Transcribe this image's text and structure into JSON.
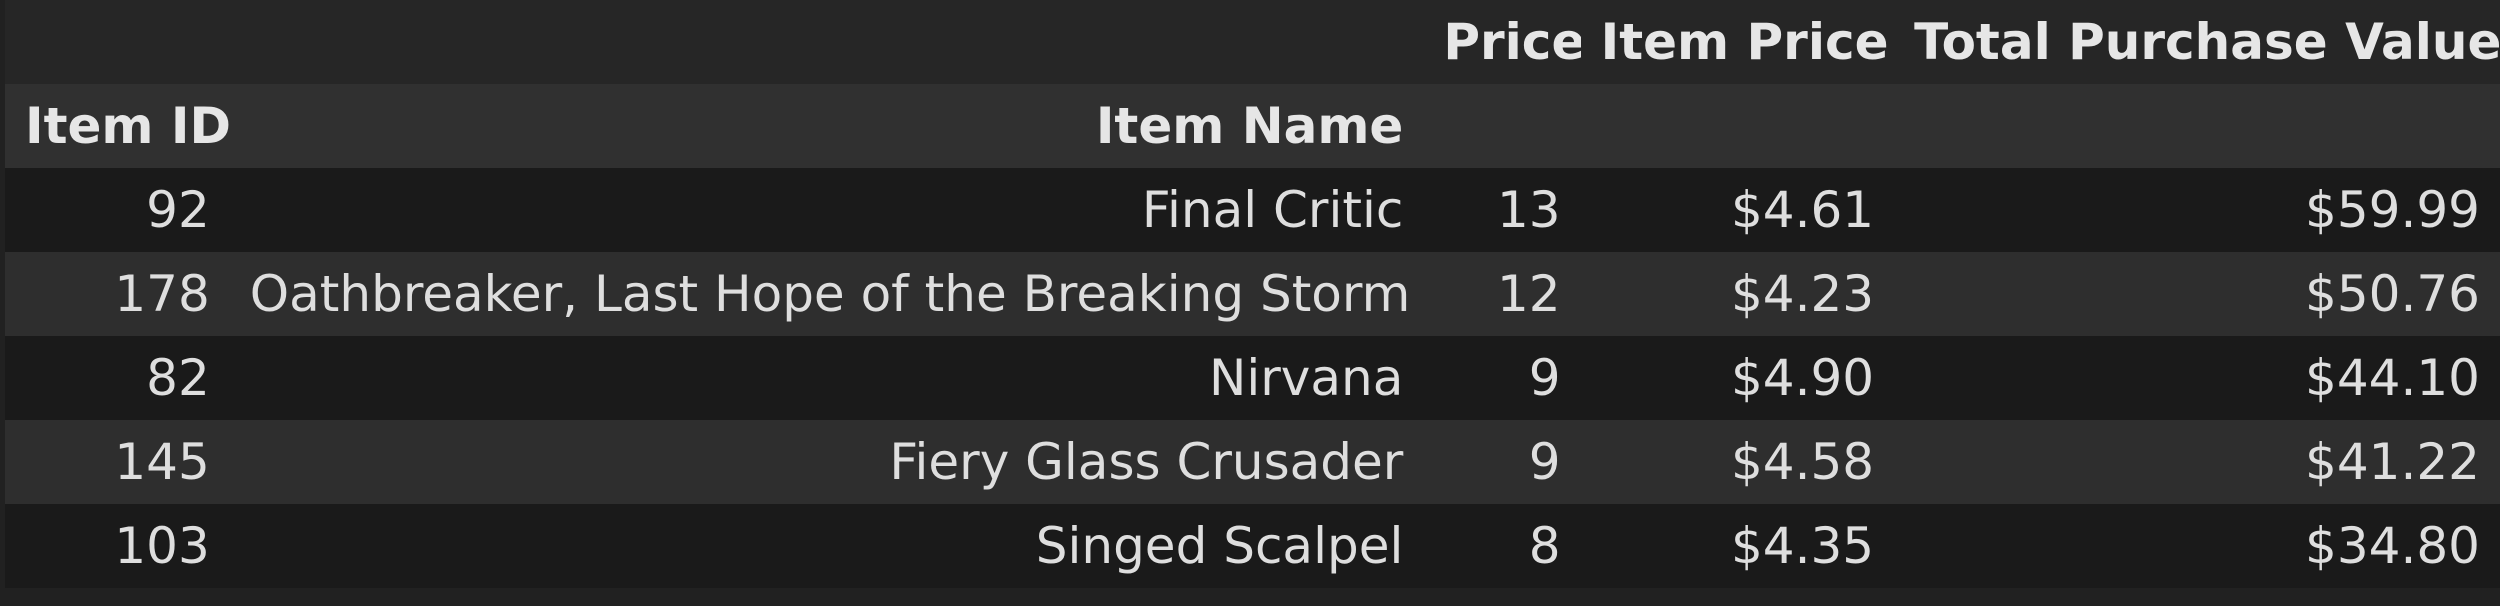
{
  "table": {
    "header_columns": [
      "Price",
      "Item Price",
      "Total Purchase Value"
    ],
    "index_names": [
      "Item ID",
      "Item Name"
    ],
    "rows": [
      {
        "item_id": "92",
        "item_name": "Final Critic",
        "price": "13",
        "item_price": "$4.61",
        "total": "$59.99"
      },
      {
        "item_id": "178",
        "item_name": "Oathbreaker, Last Hope of the Breaking Storm",
        "price": "12",
        "item_price": "$4.23",
        "total": "$50.76"
      },
      {
        "item_id": "82",
        "item_name": "Nirvana",
        "price": "9",
        "item_price": "$4.90",
        "total": "$44.10"
      },
      {
        "item_id": "145",
        "item_name": "Fiery Glass Crusader",
        "price": "9",
        "item_price": "$4.58",
        "total": "$41.22"
      },
      {
        "item_id": "103",
        "item_name": "Singed Scalpel",
        "price": "8",
        "item_price": "$4.35",
        "total": "$34.80"
      }
    ]
  },
  "colors": {
    "background": "#212121",
    "header_top": "#262626",
    "header_bottom": "#303030",
    "row_odd": "#1a1a1a",
    "row_even": "#2e2e2e",
    "text": "#dedede"
  }
}
